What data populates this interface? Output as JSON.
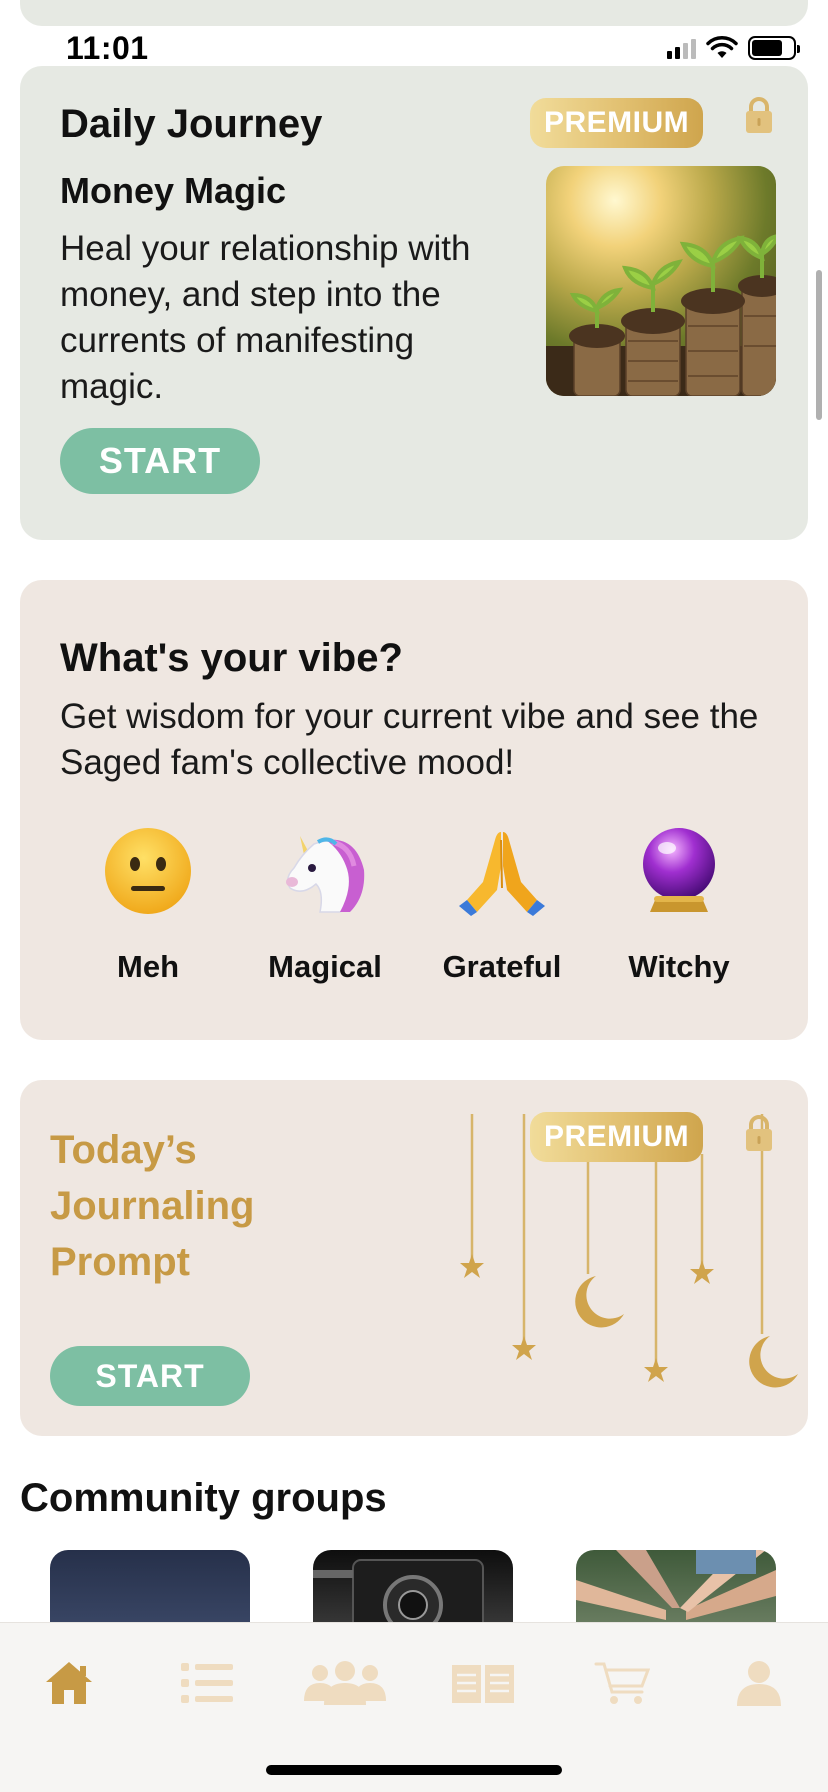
{
  "status_bar": {
    "time": "11:01"
  },
  "daily_journey": {
    "title": "Daily Journey",
    "badge": "PREMIUM",
    "subtitle": "Money Magic",
    "description": "Heal your relationship with money, and step into the currents of manifesting magic.",
    "start_label": "START"
  },
  "vibe": {
    "title": "What's your vibe?",
    "description": "Get wisdom for your current vibe and see the Saged fam's collective mood!",
    "options": [
      {
        "label": "Meh",
        "icon": "neutral-face-icon"
      },
      {
        "label": "Magical",
        "icon": "unicorn-icon"
      },
      {
        "label": "Grateful",
        "icon": "folded-hands-icon"
      },
      {
        "label": "Witchy",
        "icon": "crystal-ball-icon"
      }
    ]
  },
  "journaling_prompt": {
    "title": "Today’s Journaling Prompt",
    "badge": "PREMIUM",
    "start_label": "START"
  },
  "community": {
    "title": "Community groups"
  },
  "tab_bar": {
    "items": [
      {
        "icon": "home-icon",
        "active": true
      },
      {
        "icon": "list-icon",
        "active": false
      },
      {
        "icon": "group-icon",
        "active": false
      },
      {
        "icon": "book-icon",
        "active": false
      },
      {
        "icon": "cart-icon",
        "active": false
      },
      {
        "icon": "profile-icon",
        "active": false
      }
    ]
  },
  "colors": {
    "accent_gold": "#c79a45",
    "start_green": "#7dbfa3",
    "journey_bg": "#e6e9e3",
    "vibe_bg": "#efe7e1",
    "tab_inactive": "#efdcc0"
  }
}
